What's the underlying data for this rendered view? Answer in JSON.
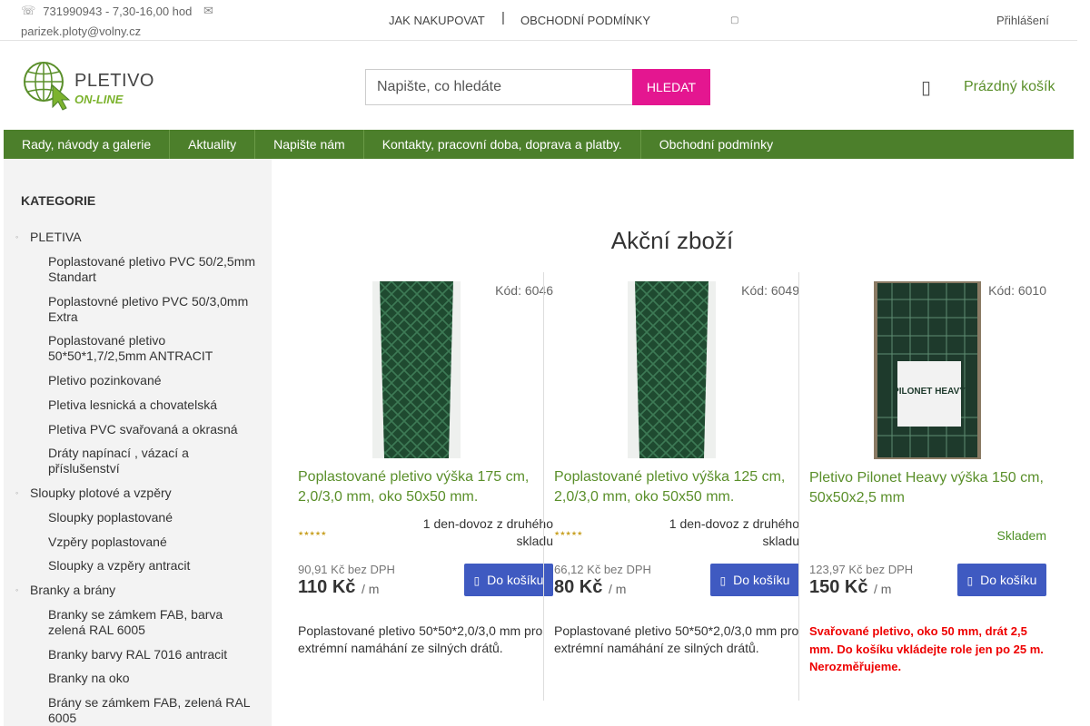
{
  "topbar": {
    "phone_icon": "phone-icon",
    "phone": "731990943 - 7,30-16,00 hod",
    "mail_icon": "envelope-icon",
    "email": "parizek.ploty@volny.cz",
    "links": [
      "JAK NAKUPOVAT",
      "OBCHODNÍ PODMÍNKY"
    ],
    "separator": "|",
    "more_icon": "more-icon",
    "login": "Přihlášení"
  },
  "header": {
    "logo_text": "PLETIVO",
    "logo_subtext": "ON-LINE",
    "search_placeholder": "Napište, co hledáte",
    "search_button": "HLEDAT",
    "cart_icon": "cart-icon",
    "cart_label": "Prázdný košík"
  },
  "mainnav": {
    "items": [
      "Rady, návody a galerie",
      "Aktuality",
      "Napište nám",
      "Kontakty, pracovní doba, doprava a platby.",
      "Obchodní podmínky"
    ]
  },
  "sidebar": {
    "heading": "KATEGORIE",
    "categories": [
      {
        "label": "PLETIVA",
        "level": 1
      },
      {
        "label": "Poplastované pletivo PVC 50/2,5mm Standart",
        "level": 2
      },
      {
        "label": "Poplastovné pletivo PVC 50/3,0mm Extra",
        "level": 2
      },
      {
        "label": "Poplastované pletivo 50*50*1,7/2,5mm ANTRACIT",
        "level": 2
      },
      {
        "label": "Pletivo pozinkované",
        "level": 2
      },
      {
        "label": "Pletiva lesnická a chovatelská",
        "level": 2
      },
      {
        "label": "Pletiva PVC svařovaná a okrasná",
        "level": 2
      },
      {
        "label": "Dráty napínací , vázací a příslušenství",
        "level": 2
      },
      {
        "label": "Sloupky plotové a vzpěry",
        "level": 1
      },
      {
        "label": "Sloupky poplastované",
        "level": 2
      },
      {
        "label": "Vzpěry poplastované",
        "level": 2
      },
      {
        "label": "Sloupky a vzpěry antracit",
        "level": 2
      },
      {
        "label": "Branky a brány",
        "level": 1
      },
      {
        "label": "Branky se zámkem FAB, barva zelená RAL 6005",
        "level": 2
      },
      {
        "label": "Branky barvy RAL 7016 antracit",
        "level": 2
      },
      {
        "label": "Branky na oko",
        "level": 2
      },
      {
        "label": "Brány se zámkem FAB, zelená RAL 6005",
        "level": 2
      }
    ]
  },
  "content": {
    "title": "Akční zboží",
    "products": [
      {
        "code": "Kód: 6046",
        "name": "Poplastované pletivo výška 175 cm, 2,0/3,0 mm, oko 50x50 mm.",
        "rating_stars": "★★★★★",
        "availability": "1 den-dovoz z druhého skladu",
        "price_net": "90,91 Kč bez DPH",
        "price": "110 Kč",
        "unit": "/ m",
        "button": "Do košíku",
        "button_icon": "cart-icon",
        "description": "Poplastované pletivo 50*50*2,0/3,0 mm pro extrémní namáhání ze silných drátů."
      },
      {
        "code": "Kód: 6049",
        "name": "Poplastované pletivo výška 125 cm, 2,0/3,0 mm, oko 50x50 mm.",
        "rating_stars": "★★★★★",
        "availability": "1 den-dovoz z druhého skladu",
        "price_net": "66,12 Kč bez DPH",
        "price": "80 Kč",
        "unit": "/ m",
        "button": "Do košíku",
        "button_icon": "cart-icon",
        "description": "Poplastované pletivo 50*50*2,0/3,0 mm pro extrémní namáhání ze silných drátů."
      },
      {
        "code": "Kód: 6010",
        "name": "Pletivo Pilonet Heavy výška 150 cm, 50x50x2,5 mm",
        "availability": "Skladem",
        "price_net": "123,97 Kč bez DPH",
        "price": "150 Kč",
        "unit": "/ m",
        "button": "Do košíku",
        "button_icon": "cart-icon",
        "description": "Svařované pletivo, oko 50 mm,  drát  2,5 mm. Do košíku vkládejte role jen po 25 m. Nerozměřujeme.",
        "label_on_roll": "PILONET HEAVY"
      }
    ]
  },
  "colors": {
    "accent_magenta": "#e41690",
    "nav_green": "#4c7f2b",
    "link_green": "#5a8f2a",
    "cart_button": "#3f5ac1",
    "alert_red": "#e00000"
  }
}
